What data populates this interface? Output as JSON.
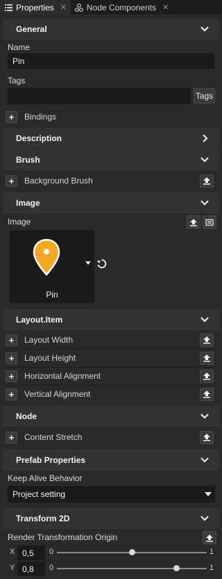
{
  "tabs": [
    {
      "label": "Properties",
      "close": "✕"
    },
    {
      "label": "Node Components",
      "close": "✕"
    }
  ],
  "sections": {
    "general": "General",
    "description": "Description",
    "brush": "Brush",
    "image": "Image",
    "layout_item": "Layout.Item",
    "node": "Node",
    "prefab": "Prefab Properties",
    "transform": "Transform 2D"
  },
  "general": {
    "name_label": "Name",
    "name_value": "Pin",
    "tags_label": "Tags",
    "tags_value": "",
    "tags_button": "Tags",
    "bindings": "Bindings"
  },
  "brush": {
    "background_brush": "Background Brush"
  },
  "image": {
    "label": "Image",
    "preview_name": "Pin",
    "pin_color": "#f5a623"
  },
  "layout_item": {
    "rows": [
      "Layout Width",
      "Layout Height",
      "Horizontal Alignment",
      "Vertical Alignment"
    ]
  },
  "node": {
    "content_stretch": "Content Stretch"
  },
  "prefab": {
    "keep_alive_label": "Keep Alive Behavior",
    "keep_alive_value": "Project setting"
  },
  "transform": {
    "origin_label": "Render Transformation Origin",
    "x_label": "X",
    "x_value": "0,5",
    "y_label": "Y",
    "y_value": "0,8",
    "min": "0",
    "max": "1",
    "x_level": 0.5,
    "y_level": 0.8
  },
  "icons": {
    "plus": "+",
    "chevron_down": "chevron-down-icon",
    "chevron_right": "chevron-right-icon",
    "move_up": "move-up-icon"
  }
}
